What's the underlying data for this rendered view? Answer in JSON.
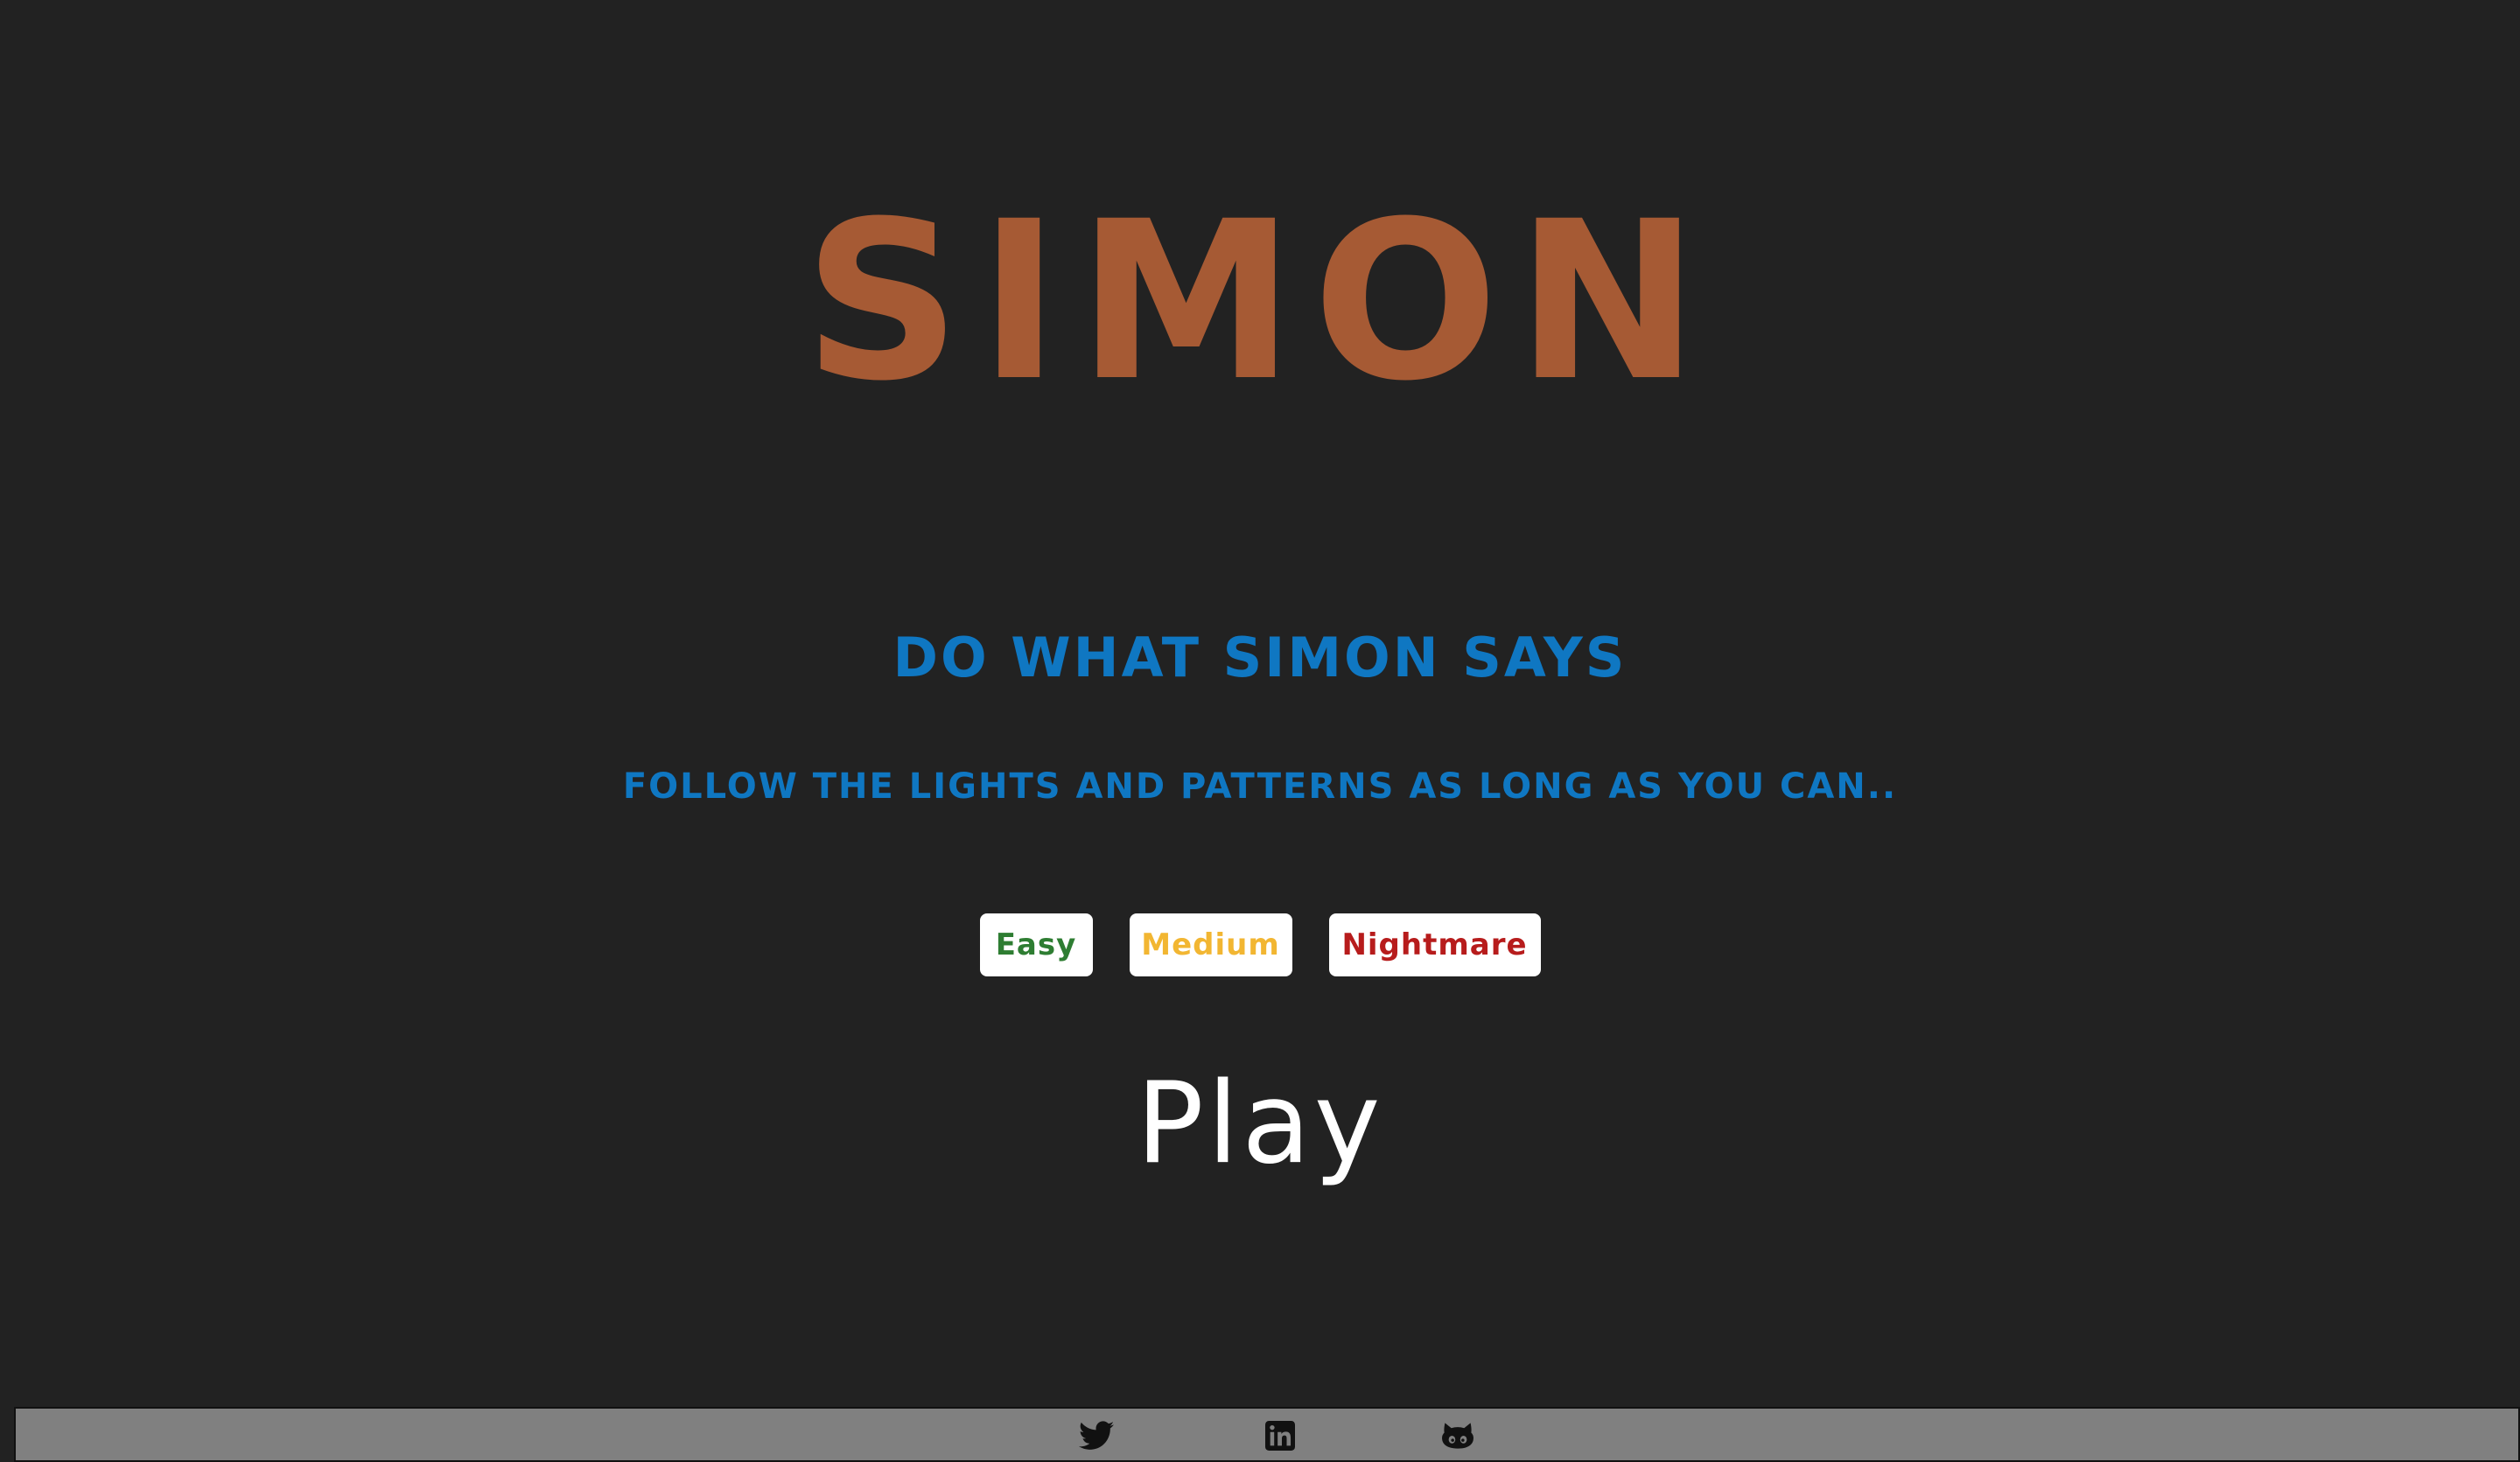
{
  "game": {
    "title": "SIMON",
    "subtitle": "DO WHAT SIMON SAYS",
    "tagline": "FOLLOW THE LIGHTS AND PATTERNS AS LONG AS YOU CAN..",
    "difficulties": [
      {
        "label": "Easy",
        "color": "#2e7d32"
      },
      {
        "label": "Medium",
        "color": "#f2b632"
      },
      {
        "label": "Nightmare",
        "color": "#b71c1c"
      }
    ],
    "play_label": "Play"
  },
  "footer": {
    "social": [
      {
        "icon": "twitter-icon"
      },
      {
        "icon": "linkedin-icon"
      },
      {
        "icon": "github-icon"
      }
    ]
  },
  "colors": {
    "background": "#222222",
    "title": "#a65a34",
    "accent": "#0f77c2",
    "footer": "#808080"
  }
}
